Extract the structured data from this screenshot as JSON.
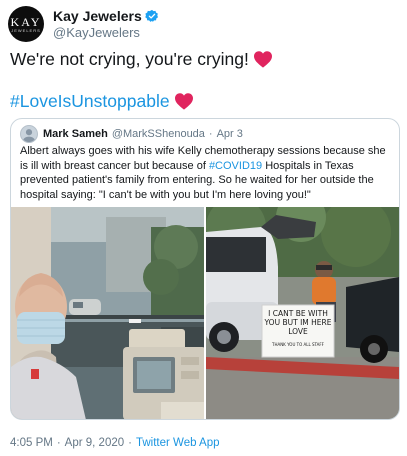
{
  "account": {
    "logo_text": "KAY",
    "logo_subtext": "JEWELERS",
    "display_name": "Kay Jewelers",
    "handle": "@KayJewelers"
  },
  "tweet": {
    "text_line1": "We're not crying, you're crying!",
    "hashtag": "#LoveIsUnstoppable"
  },
  "quoted_tweet": {
    "author_name": "Mark Sameh",
    "author_handle": "@MarkSShenouda",
    "separator": "·",
    "date": "Apr 3",
    "text_before_tag": "Albert always goes with his wife Kelly chemotherapy sessions because she is ill with breast cancer but because of ",
    "hashtag": "#COVID19",
    "text_after_tag": " Hospitals in Texas prevented patient's family from entering. So he waited for her outside the hospital saying: \"I can't be with you but I'm here loving you!\"",
    "photos": {
      "sign_line1": "I CANT BE WITH",
      "sign_line2": "YOU BUT IM HERE",
      "sign_line3": "LOVE",
      "sign_line4": "THANK YOU TO ALL STAFF"
    }
  },
  "footer": {
    "time": "4:05 PM",
    "separator": "·",
    "date": "Apr 9, 2020",
    "source": "Twitter Web App"
  },
  "colors": {
    "link_blue": "#1b95e0",
    "heart_red": "#e0245e",
    "secondary_gray": "#657786",
    "border_gray": "#ccd6dd"
  }
}
